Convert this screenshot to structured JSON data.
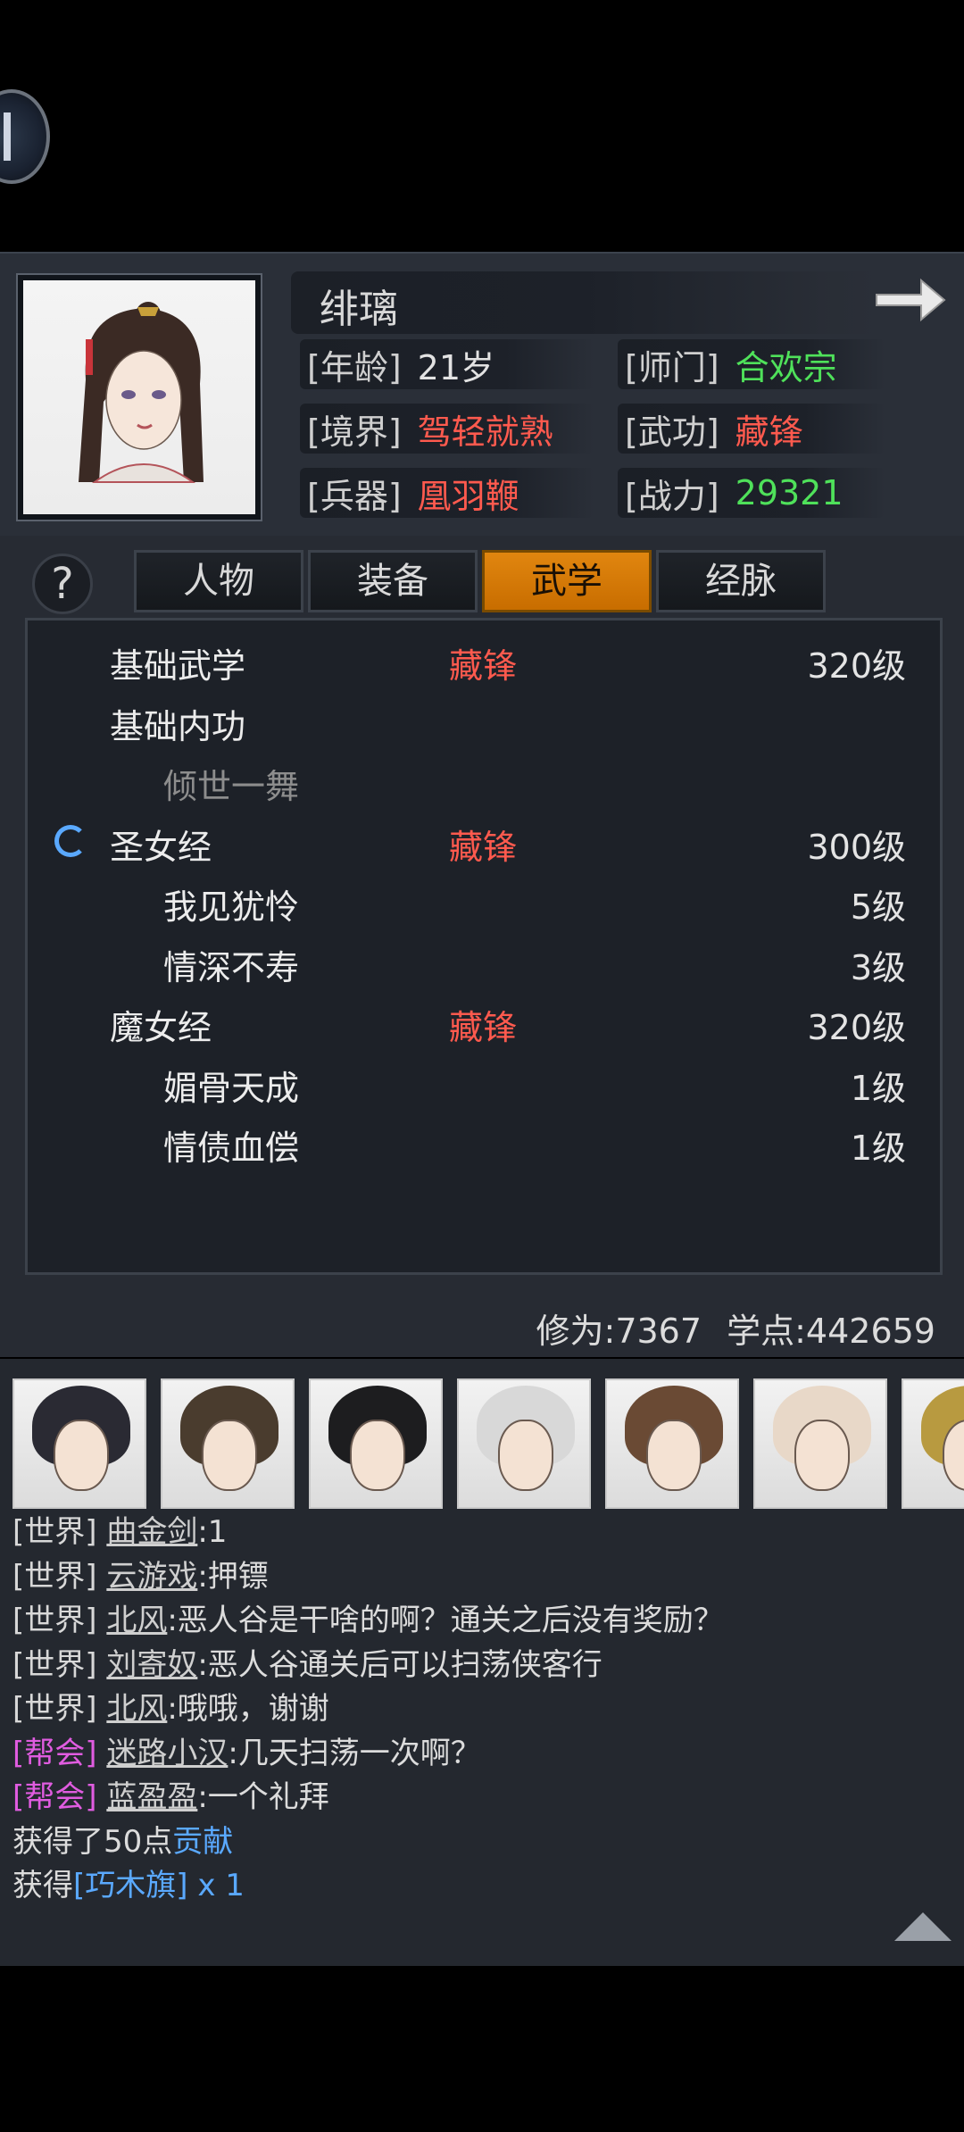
{
  "profile": {
    "name": "绯璃",
    "age_key": "[年龄]",
    "age_val": "21岁",
    "sect_key": "[师门]",
    "sect_val": "合欢宗",
    "realm_key": "[境界]",
    "realm_val": "驾轻就熟",
    "martial_key": "[武功]",
    "martial_val": "藏锋",
    "weapon_key": "[兵器]",
    "weapon_val": "凰羽鞭",
    "power_key": "[战力]",
    "power_val": "29321"
  },
  "tabs": {
    "help": "?",
    "items": [
      "人物",
      "装备",
      "武学",
      "经脉"
    ],
    "active_index": 2
  },
  "skills": [
    {
      "name": "基础武学",
      "tag": "藏锋",
      "level": "320级"
    },
    {
      "name": "基础内功",
      "tag": "",
      "level": ""
    },
    {
      "name": "倾世一舞",
      "tag": "",
      "level": ""
    },
    {
      "name": "圣女经",
      "tag": "藏锋",
      "level": "300级"
    },
    {
      "name": "我见犹怜",
      "tag": "",
      "level": "5级"
    },
    {
      "name": "情深不寿",
      "tag": "",
      "level": "3级"
    },
    {
      "name": "魔女经",
      "tag": "藏锋",
      "level": "320级"
    },
    {
      "name": "媚骨天成",
      "tag": "",
      "level": "1级"
    },
    {
      "name": "情债血偿",
      "tag": "",
      "level": "1级"
    }
  ],
  "stats": {
    "cultivation": "修为:7367",
    "points": "学点:442659"
  },
  "chat": [
    {
      "channel": "[世界]",
      "who": "曲金剑",
      "msg": ":1"
    },
    {
      "channel": "[世界]",
      "who": "云游戏",
      "msg": ":押镖"
    },
    {
      "channel": "[世界]",
      "who": "北风",
      "msg": ":恶人谷是干啥的啊？通关之后没有奖励？"
    },
    {
      "channel": "[世界]",
      "who": "刘寄奴",
      "msg": ":恶人谷通关后可以扫荡侠客行"
    },
    {
      "channel": "[世界]",
      "who": "北风",
      "msg": ":哦哦，谢谢"
    },
    {
      "channel": "[帮会]",
      "who": "迷路小汉",
      "msg": ":几天扫荡一次啊？"
    },
    {
      "channel": "[帮会]",
      "who": "蓝盈盈",
      "msg": ":一个礼拜"
    }
  ],
  "system": {
    "gain1_prefix": "获得了50点",
    "gain1_item": "贡献",
    "gain2_prefix": "获得",
    "gain2_item": "[巧木旗] x 1"
  },
  "colors": {
    "accent_orange": "#e1860f",
    "tag_red": "#ff5a4e",
    "value_green": "#4fe15a",
    "guild_magenta": "#e05ce0",
    "link_blue": "#5aa9ff"
  }
}
